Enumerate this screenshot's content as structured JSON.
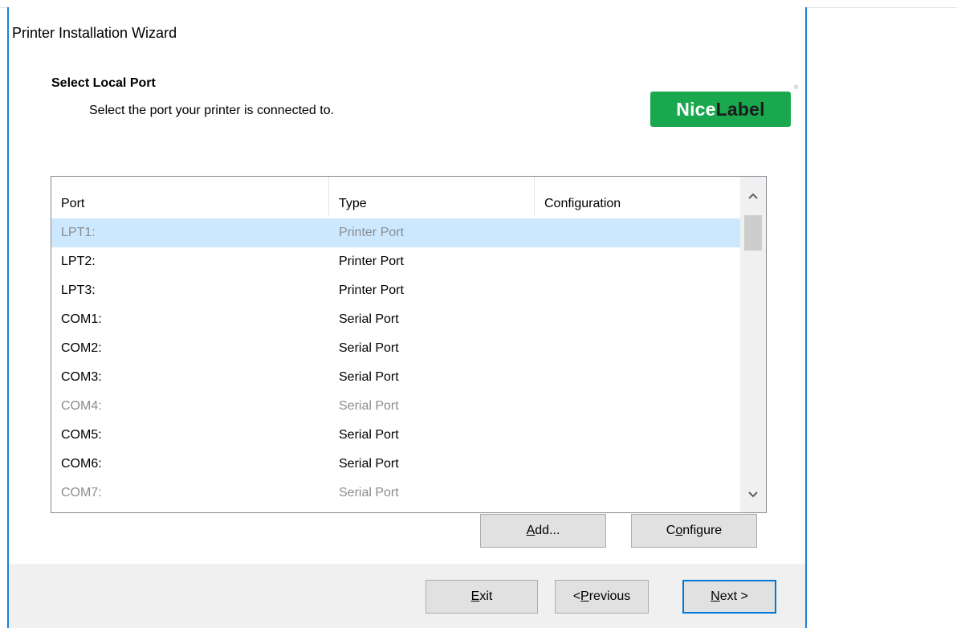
{
  "window": {
    "title": "Printer Installation Wizard"
  },
  "header": {
    "heading": "Select Local Port",
    "subheading": "Select the port your printer is connected to.",
    "logo": {
      "part1": "Nice",
      "part2": "Label",
      "mark": "®",
      "color": "#1aa84f"
    }
  },
  "ports": {
    "columns": [
      "Port",
      "Type",
      "Configuration"
    ],
    "rows": [
      {
        "port": "LPT1:",
        "type": "Printer Port",
        "config": "",
        "state": "selected"
      },
      {
        "port": "LPT2:",
        "type": "Printer Port",
        "config": "",
        "state": "normal"
      },
      {
        "port": "LPT3:",
        "type": "Printer Port",
        "config": "",
        "state": "normal"
      },
      {
        "port": "COM1:",
        "type": "Serial Port",
        "config": "",
        "state": "normal"
      },
      {
        "port": "COM2:",
        "type": "Serial Port",
        "config": "",
        "state": "normal"
      },
      {
        "port": "COM3:",
        "type": "Serial Port",
        "config": "",
        "state": "normal"
      },
      {
        "port": "COM4:",
        "type": "Serial Port",
        "config": "",
        "state": "disabled"
      },
      {
        "port": "COM5:",
        "type": "Serial Port",
        "config": "",
        "state": "normal"
      },
      {
        "port": "COM6:",
        "type": "Serial Port",
        "config": "",
        "state": "normal"
      },
      {
        "port": "COM7:",
        "type": "Serial Port",
        "config": "",
        "state": "disabled"
      }
    ],
    "scroll_up_icon": "chevron-up-icon",
    "scroll_down_icon": "chevron-down-icon"
  },
  "actions": {
    "add": {
      "pre": "",
      "key": "A",
      "post": "dd..."
    },
    "configure": {
      "pre": "C",
      "key": "o",
      "post": "nfigure"
    }
  },
  "footer": {
    "exit": {
      "pre": "",
      "key": "E",
      "post": "xit"
    },
    "previous": {
      "pre": "< ",
      "key": "P",
      "post": "revious"
    },
    "next": {
      "pre": "",
      "key": "N",
      "post": "ext >"
    }
  },
  "colors": {
    "accent": "#0078d7",
    "selection": "#cce8ff",
    "window_border": "#1e7fd8"
  }
}
